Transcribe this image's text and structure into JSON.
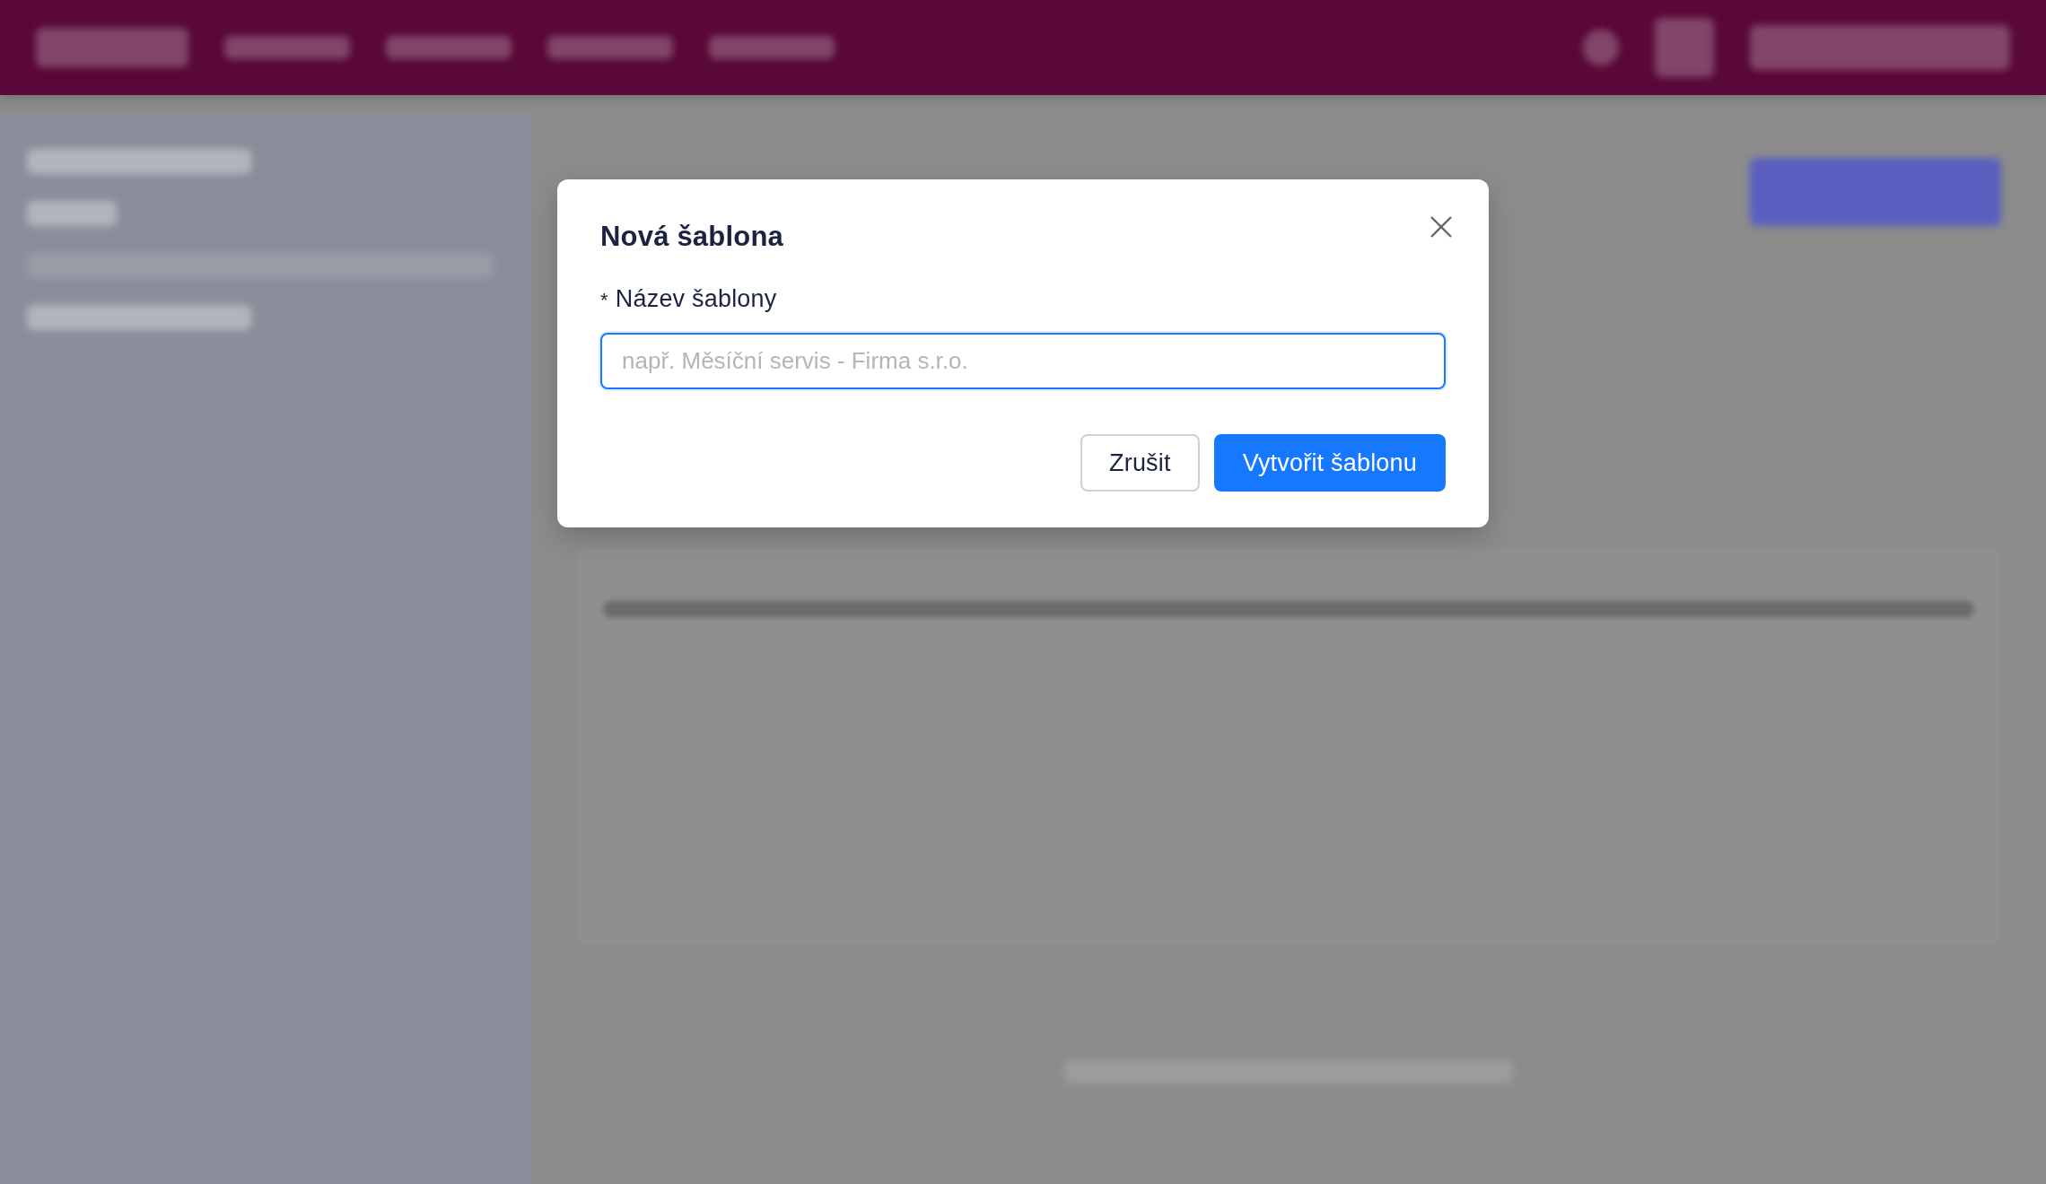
{
  "modal": {
    "title": "Nová šablona",
    "field": {
      "required_mark": "*",
      "label": "Název šablony",
      "placeholder": "např. Měsíční servis - Firma s.r.o.",
      "focused": true
    },
    "buttons": [
      {
        "label": "Zrušit",
        "kind": "secondary"
      },
      {
        "label": "Vytvořit šablonu",
        "kind": "primary"
      }
    ]
  }
}
